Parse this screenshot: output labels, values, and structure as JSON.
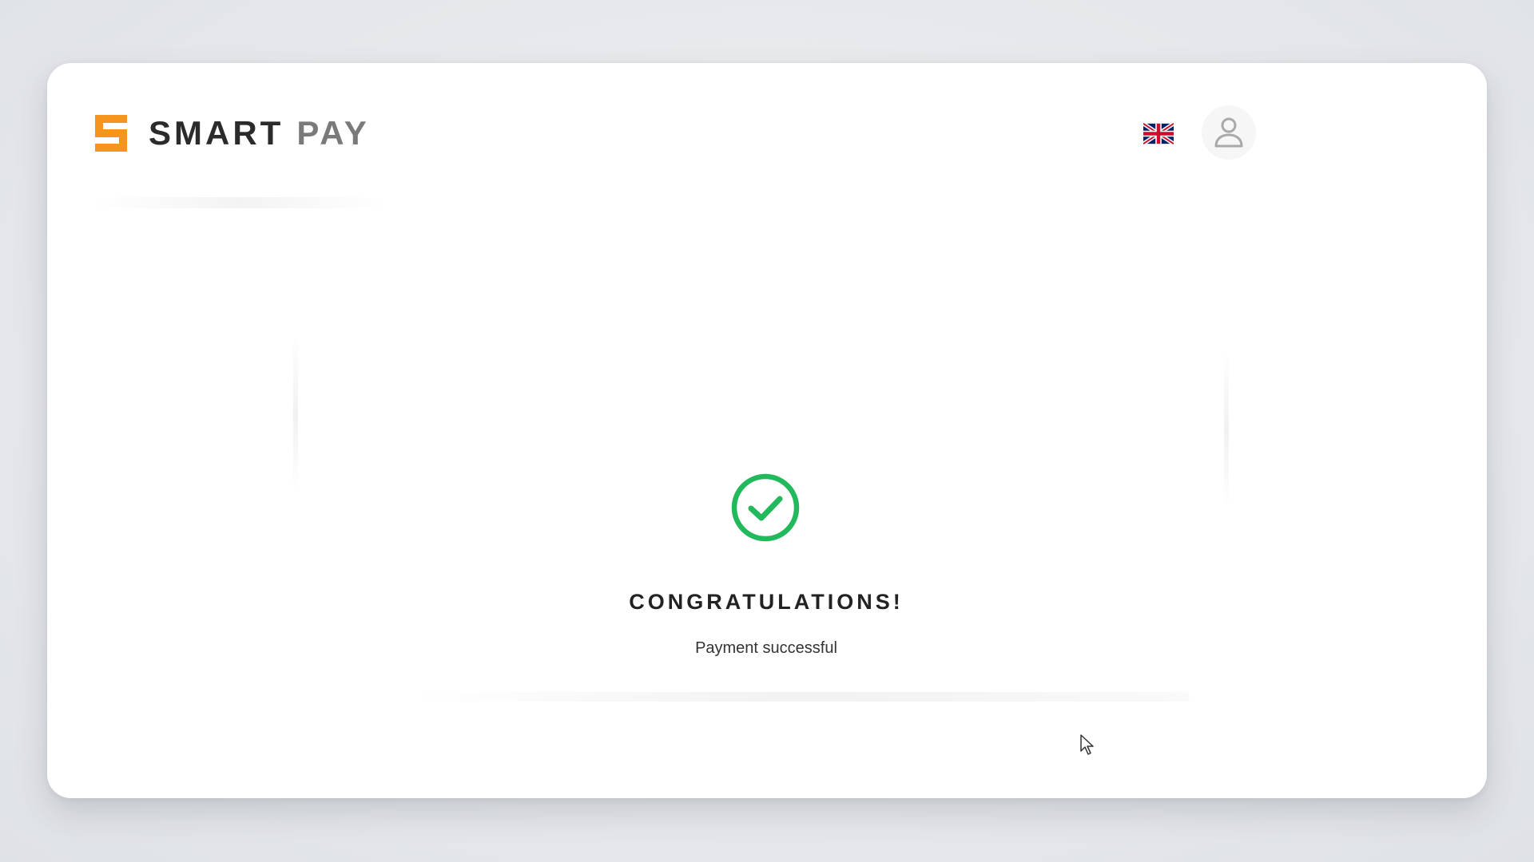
{
  "header": {
    "logo": {
      "word1": "SMART",
      "word2": "PAY",
      "mark_color": "#F7941D",
      "word1_color": "#2B2B2B",
      "word2_color": "#7A7A7A"
    },
    "language_icon": "uk-flag-icon",
    "user_icon": "user-icon"
  },
  "result": {
    "icon": "check-circle-icon",
    "icon_color": "#22B85C",
    "title": "CONGRATULATIONS!",
    "message": "Payment successful"
  },
  "cursor_icon": "mouse-pointer-icon"
}
